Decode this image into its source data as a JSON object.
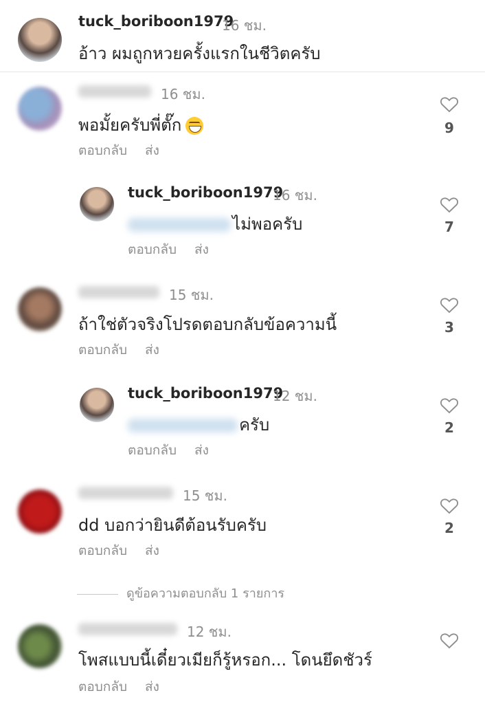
{
  "caption": {
    "username": "tuck_boriboon1979",
    "time": "16 ชม.",
    "text": "อ้าว ผมถูกหวยครั้งแรกในชีวิตครับ"
  },
  "labels": {
    "reply": "ตอบกลับ",
    "send": "ส่ง"
  },
  "comments": [
    {
      "time": "16 ชม.",
      "text": "พอมั้ยครับพี่ตั๊ก",
      "emoji": "grinning-squinting-face",
      "likes": "9"
    },
    {
      "username": "tuck_boriboon1979",
      "time": "16 ชม.",
      "text": "ไม่พอครับ",
      "likes": "7"
    },
    {
      "time": "15 ชม.",
      "text": "ถ้าใช่ตัวจริงโปรดตอบกลับข้อความนี้",
      "likes": "3"
    },
    {
      "username": "tuck_boriboon1979",
      "time": "12 ชม.",
      "text": "ครับ",
      "likes": "2"
    },
    {
      "time": "15 ชม.",
      "text": "dd บอกว่ายินดีต้อนรับครับ",
      "likes": "2"
    },
    {
      "time": "12 ชม.",
      "text": "โพสแบบนี้เดี๋ยวเมียก็รู้หรอก... โดนยึดชัวร์"
    }
  ],
  "view_replies": "ดูข้อความตอบกลับ 1 รายการ",
  "icons": {
    "like": "heart-outline-icon"
  }
}
